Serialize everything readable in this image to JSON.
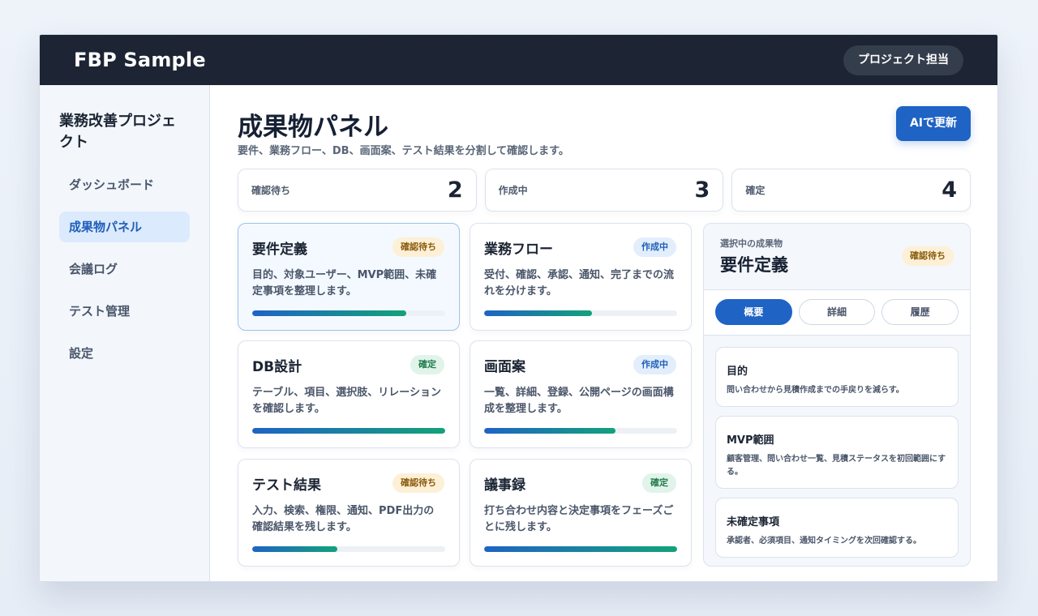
{
  "app": {
    "brand": "FBP Sample",
    "role": "プロジェクト担当"
  },
  "sidebar": {
    "project": "業務改善プロジェクト",
    "items": [
      {
        "label": "ダッシュボード"
      },
      {
        "label": "成果物パネル"
      },
      {
        "label": "会議ログ"
      },
      {
        "label": "テスト管理"
      },
      {
        "label": "設定"
      }
    ]
  },
  "page": {
    "title": "成果物パネル",
    "subtitle": "要件、業務フロー、DB、画面案、テスト結果を分割して確認します。",
    "action": "AIで更新"
  },
  "stats": [
    {
      "label": "確認待ち",
      "value": "2"
    },
    {
      "label": "作成中",
      "value": "3"
    },
    {
      "label": "確定",
      "value": "4"
    }
  ],
  "cards": [
    {
      "title": "要件定義",
      "status": "確認待ち",
      "desc": "目的、対象ユーザー、MVP範囲、未確定事項を整理します。",
      "progress": 0.8
    },
    {
      "title": "業務フロー",
      "status": "作成中",
      "desc": "受付、確認、承認、通知、完了までの流れを分けます。",
      "progress": 0.56
    },
    {
      "title": "DB設計",
      "status": "確定",
      "desc": "テーブル、項目、選択肢、リレーションを確認します。",
      "progress": 1.0
    },
    {
      "title": "画面案",
      "status": "作成中",
      "desc": "一覧、詳細、登録、公開ページの画面構成を整理します。",
      "progress": 0.68
    },
    {
      "title": "テスト結果",
      "status": "確認待ち",
      "desc": "入力、検索、権限、通知、PDF出力の確認結果を残します。",
      "progress": 0.44
    },
    {
      "title": "議事録",
      "status": "確定",
      "desc": "打ち合わせ内容と決定事項をフェーズごとに残します。",
      "progress": 1.0
    }
  ],
  "detail": {
    "kicker": "選択中の成果物",
    "title": "要件定義",
    "status": "確認待ち",
    "tabs": [
      {
        "label": "概要"
      },
      {
        "label": "詳細"
      },
      {
        "label": "履歴"
      }
    ],
    "sections": [
      {
        "title": "目的",
        "body": "問い合わせから見積作成までの手戻りを減らす。"
      },
      {
        "title": "MVP範囲",
        "body": "顧客管理、問い合わせ一覧、見積ステータスを初回範囲にする。"
      },
      {
        "title": "未確定事項",
        "body": "承認者、必須項目、通知タイミングを次回確認する。"
      }
    ]
  },
  "colors": {
    "topbar": "#1d2534",
    "accent": "#1f63c5",
    "pending_bg": "#fdf0d6",
    "progress_bg": "#e3eefc",
    "done_bg": "#e0f4ea"
  }
}
